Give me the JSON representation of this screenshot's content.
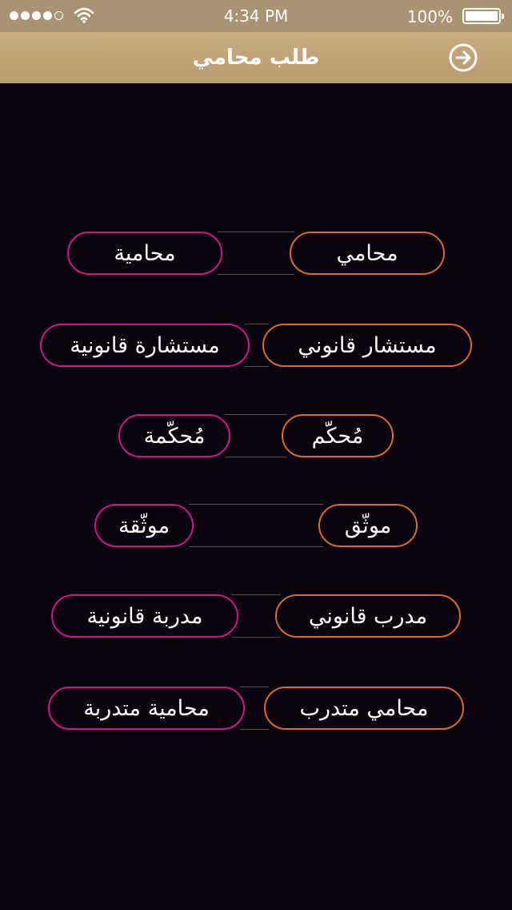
{
  "status_bar": {
    "time": "4:34 PM",
    "battery": "100%"
  },
  "nav": {
    "title": "طلب محامي"
  },
  "pairs": [
    {
      "male": "محامي",
      "female": "محامية"
    },
    {
      "male": "مستشار قانوني",
      "female": "مستشارة قانونية"
    },
    {
      "male": "مُحكّم",
      "female": "مُحكّمة"
    },
    {
      "male": "موثّق",
      "female": "موثّقة"
    },
    {
      "male": "مدرب قانوني",
      "female": "مدربة قانونية"
    },
    {
      "male": "محامي متدرب",
      "female": "محامية متدربة"
    }
  ]
}
